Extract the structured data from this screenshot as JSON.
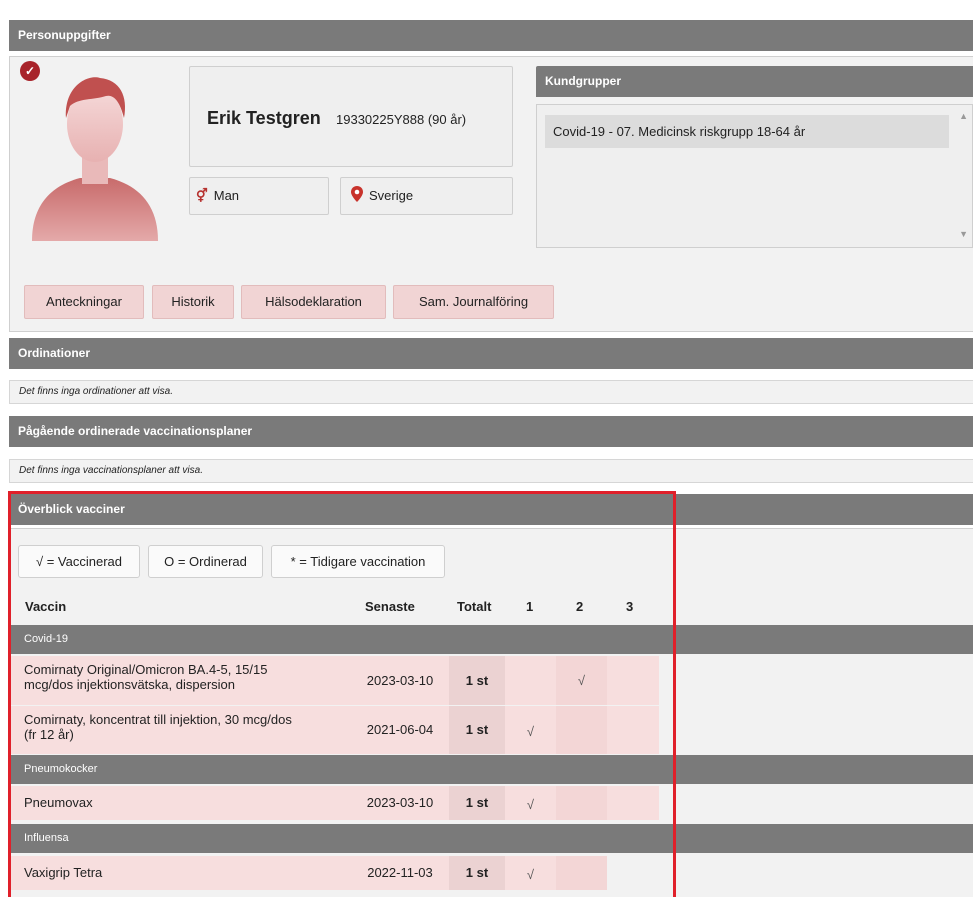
{
  "personuppgifter": {
    "header": "Personuppgifter",
    "verified_icon": "check-circle-icon",
    "avatar_icon": "person-avatar-icon",
    "name": "Erik Testgren",
    "personnummer": "19330225Y888 (90 år)",
    "gender_icon": "gender-male-female-icon",
    "gender": "Man",
    "country_icon": "map-pin-icon",
    "country": "Sverige"
  },
  "kundgrupper": {
    "header": "Kundgrupper",
    "items": [
      "Covid-19 - 07. Medicinsk riskgrupp 18-64 år"
    ]
  },
  "actions": [
    "Anteckningar",
    "Historik",
    "Hälsodeklaration",
    "Sam. Journalföring"
  ],
  "ordinationer": {
    "header": "Ordinationer",
    "empty_text": "Det finns inga ordinationer att visa."
  },
  "vaccinationsplaner": {
    "header": "Pågående ordinerade vaccinationsplaner",
    "empty_text": "Det finns inga vaccinationsplaner att visa."
  },
  "overblick": {
    "header": "Överblick vacciner",
    "legend": [
      "√ = Vaccinerad",
      "O = Ordinerad",
      "* = Tidigare vaccination"
    ],
    "columns": [
      "Vaccin",
      "Senaste",
      "Totalt",
      "1",
      "2",
      "3"
    ],
    "groups": [
      {
        "name": "Covid-19",
        "rows": [
          {
            "vaccin_line1": "Comirnaty Original/Omicron BA.4-5, 15/15",
            "vaccin_line2": "mcg/dos injektionsvätska, dispersion",
            "senaste": "2023-03-10",
            "totalt": "1 st",
            "d1": "",
            "d2": "√",
            "d3": ""
          },
          {
            "vaccin_line1": "Comirnaty, koncentrat till injektion, 30 mcg/dos",
            "vaccin_line2": "(fr 12 år)",
            "senaste": "2021-06-04",
            "totalt": "1 st",
            "d1": "√",
            "d2": "",
            "d3": ""
          }
        ]
      },
      {
        "name": "Pneumokocker",
        "rows": [
          {
            "vaccin_line1": "Pneumovax",
            "vaccin_line2": "",
            "senaste": "2023-03-10",
            "totalt": "1 st",
            "d1": "√",
            "d2": "",
            "d3": ""
          }
        ]
      },
      {
        "name": "Influensa",
        "rows": [
          {
            "vaccin_line1": "Vaxigrip Tetra",
            "vaccin_line2": "",
            "senaste": "2022-11-03",
            "totalt": "1 st",
            "d1": "√",
            "d2": "",
            "d3": ""
          }
        ]
      }
    ]
  },
  "colors": {
    "header_gray": "#7a7a7a",
    "accent_red": "#b6322f",
    "row_pink": "#f7dede",
    "button_pink": "#f1d4d4",
    "highlight": "#e0202a"
  }
}
